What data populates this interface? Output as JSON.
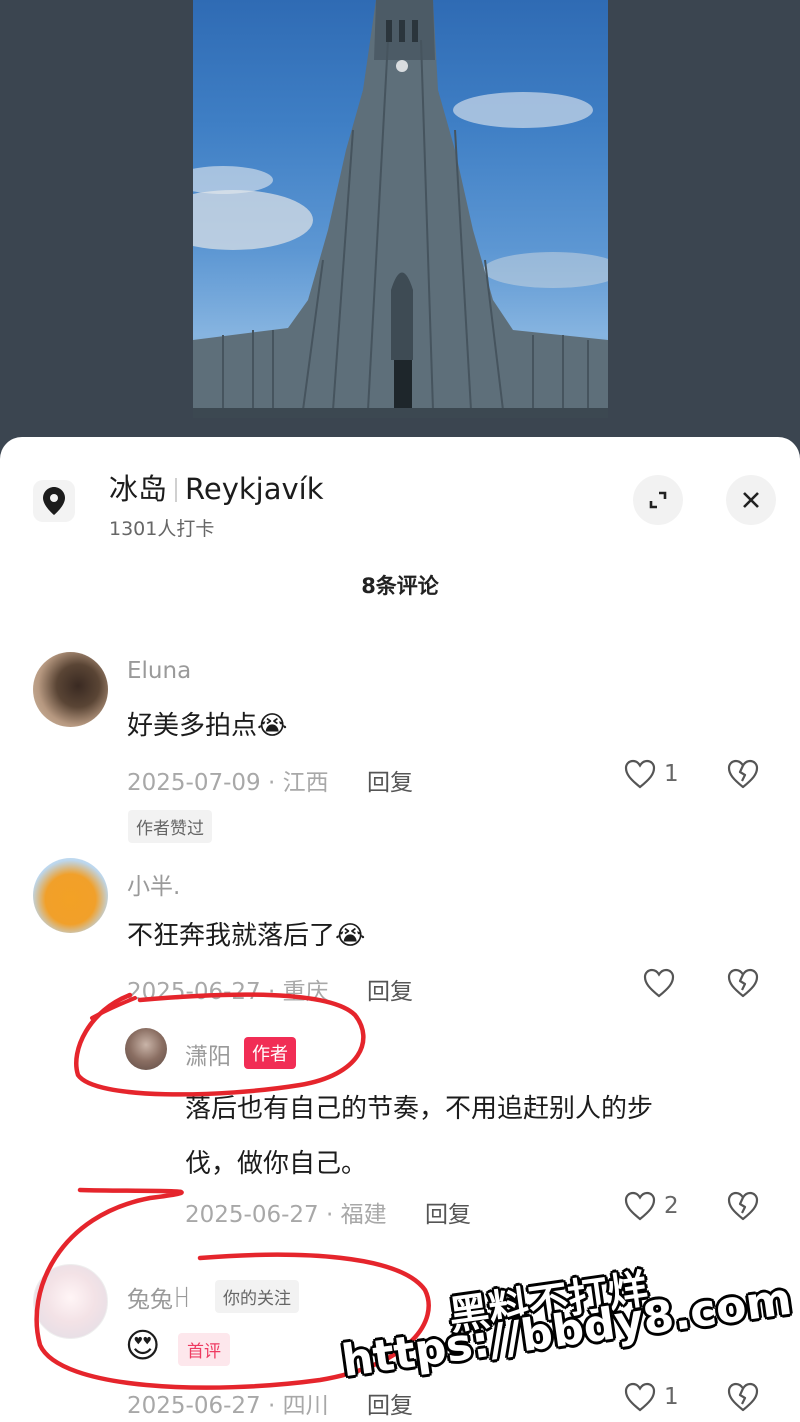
{
  "location": {
    "name_cn": "冰岛",
    "name_local": "Reykjavík",
    "checkins": "1301人打卡"
  },
  "comments_header": "8条评论",
  "comments": [
    {
      "user": "Eluna",
      "text": "好美多拍点",
      "emoji": "😭",
      "meta": "2025-07-09 · 江西",
      "reply_label": "回复",
      "likes": "1",
      "badge": "作者赞过"
    },
    {
      "user": "小半.",
      "text": "不狂奔我就落后了",
      "emoji": "😭",
      "meta": "2025-06-27 · 重庆",
      "reply_label": "回复",
      "likes": ""
    }
  ],
  "author_reply": {
    "user": "潇阳",
    "tag": "作者",
    "text_line1": "落后也有自己的节奏，不用追赶别人的步",
    "text_line2": "伐，做你自己。",
    "meta": "2025-06-27 · 福建",
    "reply_label": "回复",
    "likes": "2"
  },
  "third_comment": {
    "user": "兔兔ꀿ",
    "follow_tag": "你的关注",
    "emoji": "😍",
    "first_tag": "首评",
    "meta": "2025-06-27 · 四川",
    "reply_label": "回复",
    "likes": "1"
  },
  "watermark": {
    "line1": "黑料不打烊",
    "line2": "https://bbdy8.com"
  },
  "colors": {
    "accent_red": "#f12d55",
    "annotation_red": "#e5252c"
  }
}
